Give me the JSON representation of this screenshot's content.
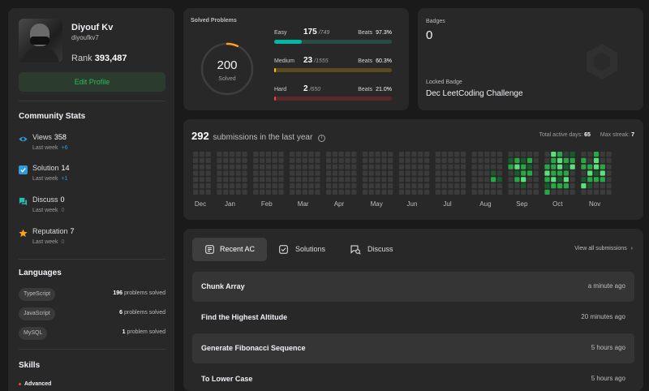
{
  "profile": {
    "name": "Diyouf Kv",
    "username": "diyoufkv7",
    "rank_label": "Rank",
    "rank_value": "393,487",
    "edit_label": "Edit Profile"
  },
  "community": {
    "title": "Community Stats",
    "items": [
      {
        "label": "Views",
        "value": "358",
        "sub": "Last week",
        "delta": "+6",
        "icon": "eye-icon",
        "color": "#2d9cdb",
        "delta_color": "#2d9cdb"
      },
      {
        "label": "Solution",
        "value": "14",
        "sub": "Last week",
        "delta": "+1",
        "icon": "solution-check-icon",
        "color": "#2d9cdb",
        "delta_color": "#2d9cdb"
      },
      {
        "label": "Discuss",
        "value": "0",
        "sub": "Last week",
        "delta": "0",
        "icon": "discuss-icon",
        "color": "#2cbbb0",
        "delta_color": "#6b6b6b"
      },
      {
        "label": "Reputation",
        "value": "7",
        "sub": "Last week",
        "delta": "0",
        "icon": "star-icon",
        "color": "#ffa116",
        "delta_color": "#6b6b6b"
      }
    ]
  },
  "languages": {
    "title": "Languages",
    "items": [
      {
        "name": "TypeScript",
        "count": "196",
        "unit": "problems solved"
      },
      {
        "name": "JavaScript",
        "count": "6",
        "unit": "problems solved"
      },
      {
        "name": "MySQL",
        "count": "1",
        "unit": "problem solved"
      }
    ]
  },
  "skills": {
    "title": "Skills",
    "level": "Advanced"
  },
  "solved": {
    "title": "Solved Problems",
    "total": "200",
    "total_label": "Solved",
    "difficulties": [
      {
        "name": "Easy",
        "solved": 175,
        "total": 749,
        "total_text": "/749",
        "beats_label": "Beats",
        "beats": "97.3%",
        "color": "#00b8a3",
        "track": "#2b4a44"
      },
      {
        "name": "Medium",
        "solved": 23,
        "total": 1555,
        "total_text": "/1555",
        "beats_label": "Beats",
        "beats": "60.3%",
        "color": "#ffc01e",
        "track": "#5a4b1f"
      },
      {
        "name": "Hard",
        "solved": 2,
        "total": 650,
        "total_text": "/650",
        "beats_label": "Beats",
        "beats": "21.0%",
        "color": "#ef4743",
        "track": "#5a2828"
      }
    ]
  },
  "badges": {
    "label": "Badges",
    "count": "0",
    "locked_label": "Locked Badge",
    "locked_name": "Dec LeetCoding Challenge"
  },
  "calendar": {
    "count": "292",
    "count_text": "submissions in the last year",
    "info_icon": "info-icon",
    "active_days_label": "Total active days:",
    "active_days": "65",
    "max_streak_label": "Max streak:",
    "max_streak": "7",
    "months": [
      "Dec",
      "Jan",
      "Feb",
      "Mar",
      "Apr",
      "May",
      "Jun",
      "Jul",
      "Aug",
      "Sep",
      "Oct",
      "Nov"
    ],
    "levels": {
      "Aug": [
        0,
        0,
        0,
        0,
        0,
        0,
        0,
        0,
        0,
        0,
        0,
        0,
        0,
        0,
        0,
        0,
        0,
        0,
        0,
        0,
        0,
        0,
        0,
        0,
        1,
        2,
        0,
        0,
        0,
        0,
        0,
        0,
        1,
        0,
        0
      ],
      "Sep": [
        0,
        1,
        2,
        0,
        0,
        0,
        0,
        0,
        2,
        3,
        1,
        2,
        0,
        0,
        0,
        1,
        2,
        2,
        3,
        1,
        0,
        0,
        2,
        1,
        2,
        0,
        0,
        0,
        0,
        0,
        0,
        0,
        0,
        0,
        0
      ],
      "Oct": [
        0,
        0,
        2,
        3,
        2,
        1,
        2,
        3,
        2,
        2,
        2,
        3,
        2,
        0,
        2,
        3,
        3,
        2,
        1,
        2,
        0,
        0,
        2,
        1,
        2,
        3,
        2,
        0,
        1,
        2,
        3,
        0,
        0,
        0,
        0
      ],
      "Nov": [
        0,
        2,
        2,
        0,
        1,
        3,
        0,
        0,
        0,
        2,
        3,
        2,
        1,
        0,
        2,
        3,
        3,
        1,
        2,
        0,
        0,
        0,
        0,
        2,
        3,
        2,
        0,
        0,
        0,
        0,
        0,
        0,
        0,
        0,
        0
      ]
    },
    "level_colors": [
      "#3b3b3b",
      "#1a5a2c",
      "#28a745",
      "#5be07b"
    ]
  },
  "recent": {
    "tabs": [
      {
        "label": "Recent AC",
        "icon": "recent-ac-icon",
        "active": true
      },
      {
        "label": "Solutions",
        "icon": "solutions-icon",
        "active": false
      },
      {
        "label": "Discuss",
        "icon": "discuss-search-icon",
        "active": false
      }
    ],
    "view_all": "View all submissions",
    "items": [
      {
        "title": "Chunk Array",
        "time": "a minute ago"
      },
      {
        "title": "Find the Highest Altitude",
        "time": "20 minutes ago"
      },
      {
        "title": "Generate Fibonacci Sequence",
        "time": "5 hours ago"
      },
      {
        "title": "To Lower Case",
        "time": "5 hours ago"
      }
    ]
  }
}
